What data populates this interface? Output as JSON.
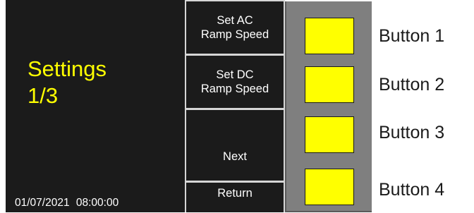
{
  "screen": {
    "title": "Settings\n1/3",
    "datetime": "01/07/2021  08:00:00",
    "title_color": "#ffff00",
    "background": "#1b1b1b"
  },
  "softkeys": [
    {
      "label": "Set AC\nRamp Speed"
    },
    {
      "label": "Set DC\nRamp Speed"
    },
    {
      "label": "Next"
    },
    {
      "label": "Return"
    }
  ],
  "buttons": [
    {
      "label": "Button 1",
      "color": "#ffff00"
    },
    {
      "label": "Button 2",
      "color": "#ffff00"
    },
    {
      "label": "Button 3",
      "color": "#ffff00"
    },
    {
      "label": "Button 4",
      "color": "#ffff00"
    }
  ]
}
